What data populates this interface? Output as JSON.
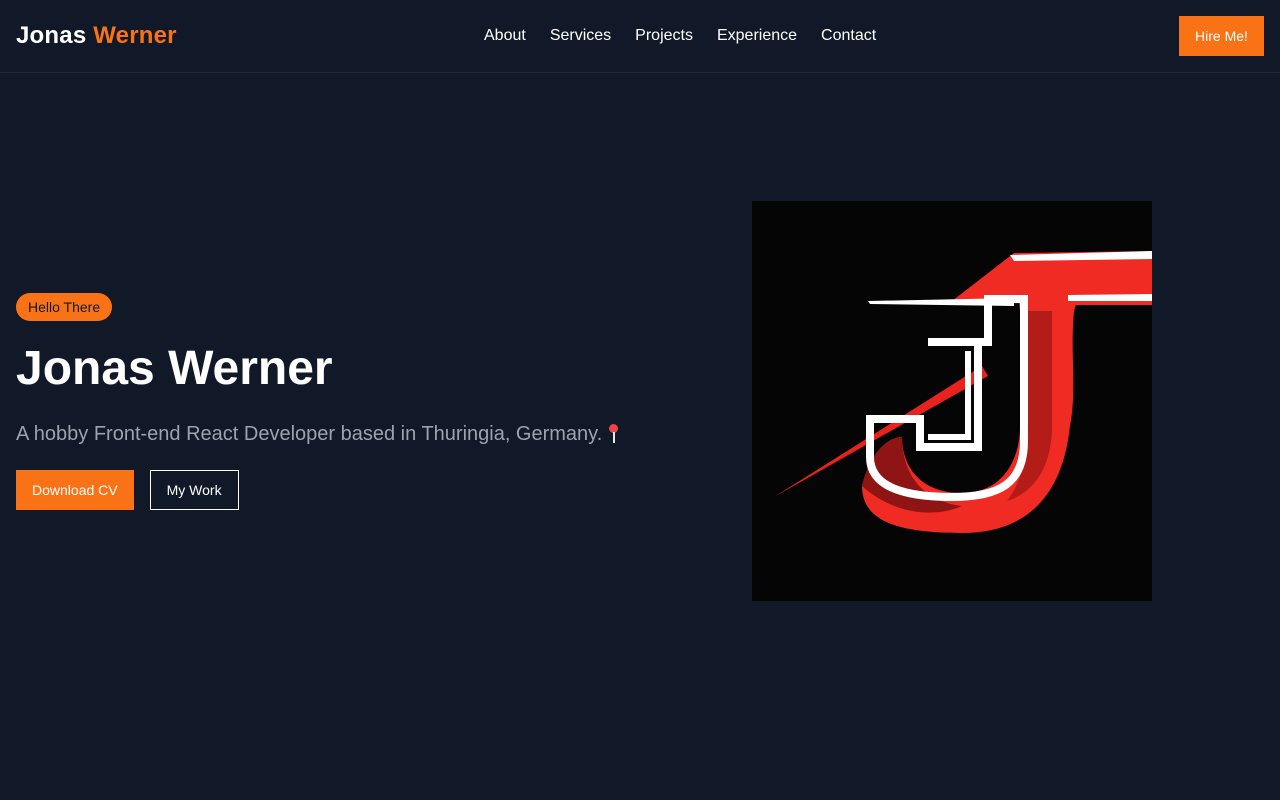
{
  "brand": {
    "first": "Jonas",
    "last": "Werner"
  },
  "nav": {
    "links": [
      "About",
      "Services",
      "Projects",
      "Experience",
      "Contact"
    ],
    "cta_label": "Hire Me!"
  },
  "hero": {
    "badge": "Hello There",
    "title": "Jonas Werner",
    "subtitle": "A hobby Front-end React Developer based in Thuringia, Germany.",
    "subtitle_icon": "round-pushpin-icon",
    "primary_button": "Download CV",
    "secondary_button": "My Work",
    "image": {
      "icon": "jw-logo-icon",
      "colors": {
        "background": "#050505",
        "red": "#ef2b24",
        "dark_red": "#8f1515",
        "white": "#ffffff"
      }
    }
  },
  "colors": {
    "background": "#111827",
    "accent": "#f97316",
    "muted_text": "#9ca3af"
  }
}
